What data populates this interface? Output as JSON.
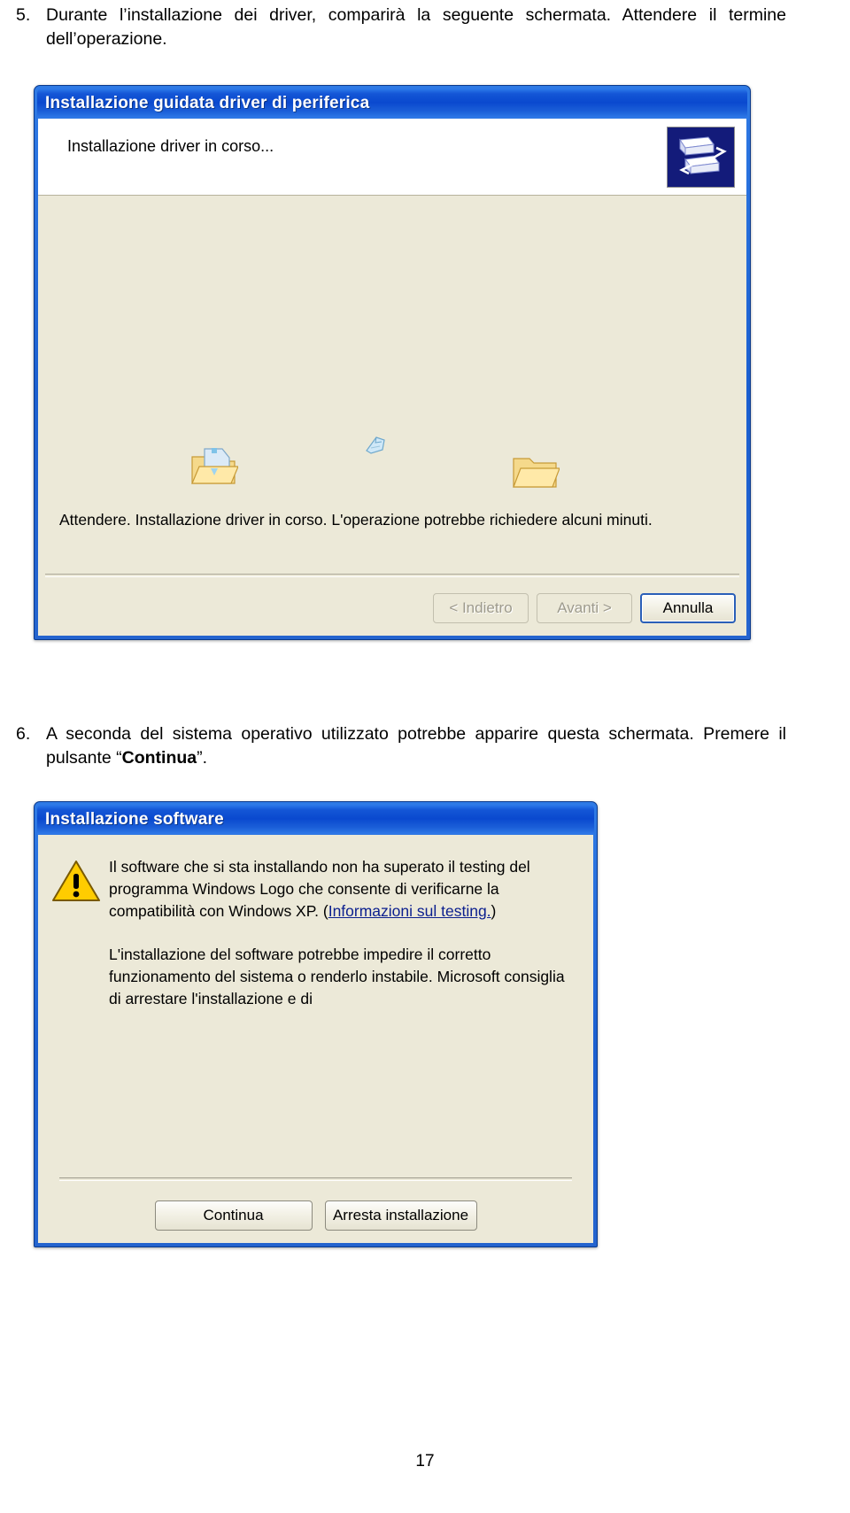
{
  "document": {
    "steps": [
      {
        "number": "5.",
        "text": "Durante l’installazione dei driver, comparirà la seguente schermata. Attendere il termine dell’operazione."
      },
      {
        "number": "6.",
        "text_before": "A seconda del sistema operativo utilizzato potrebbe apparire questa schermata. Premere il pulsante “",
        "emphasis": "Continua",
        "text_after": "”."
      }
    ],
    "page_number": "17"
  },
  "wizard_dialog": {
    "title": "Installazione guidata driver di periferica",
    "header_title": "Installazione driver in corso...",
    "header_icon": "device-driver-icon",
    "animation": {
      "source_folder_icon": "open-folder-with-document-icon",
      "flying_page_icon": "flying-document-icon",
      "destination_folder_icon": "open-folder-icon"
    },
    "caption": "Attendere. Installazione driver in corso. L'operazione potrebbe richiedere alcuni minuti.",
    "buttons": [
      {
        "label": "< Indietro",
        "state": "disabled",
        "name": "back-button"
      },
      {
        "label": "Avanti >",
        "state": "disabled",
        "name": "next-button"
      },
      {
        "label": "Annulla",
        "state": "default",
        "name": "cancel-button"
      }
    ]
  },
  "warning_dialog": {
    "title": "Installazione software",
    "icon": "warning-triangle-icon",
    "paragraph_1_part_1": "Il software che si sta installando non ha superato il testing del programma Windows Logo che consente di verificarne la compatibilità con Windows XP. (",
    "paragraph_1_link": "Informazioni sul testing.",
    "paragraph_1_part_2": ")",
    "paragraph_2": "L'installazione del software potrebbe impedire il corretto funzionamento del sistema o renderlo instabile. Microsoft consiglia di arrestare l'installazione e di",
    "buttons": [
      {
        "label": "Continua",
        "name": "continue-button"
      },
      {
        "label": "Arresta installazione",
        "name": "stop-install-button"
      }
    ]
  },
  "colors": {
    "titlebar_blue": "#0a49cf",
    "dialog_face": "#ece9d8",
    "warning_yellow": "#ffcc00",
    "link_blue": "#0b1f8e",
    "default_button_border": "#2a5fb8"
  }
}
